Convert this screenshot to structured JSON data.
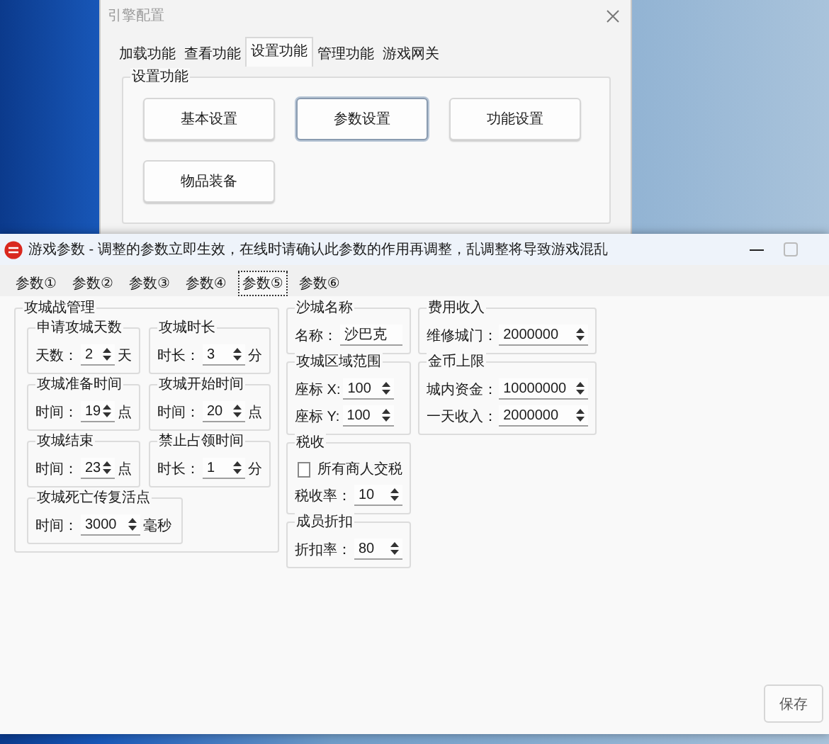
{
  "background_window": {
    "title": "引擎配置",
    "tabs": [
      {
        "label": "加载功能",
        "selected": false
      },
      {
        "label": "查看功能",
        "selected": false
      },
      {
        "label": "设置功能",
        "selected": true
      },
      {
        "label": "管理功能",
        "selected": false
      },
      {
        "label": "游戏网关",
        "selected": false
      }
    ],
    "group": {
      "title": "设置功能",
      "buttons": [
        {
          "label": "基本设置",
          "focused": false
        },
        {
          "label": "参数设置",
          "focused": true
        },
        {
          "label": "功能设置",
          "focused": false
        },
        {
          "label": "物品装备",
          "focused": false
        }
      ]
    }
  },
  "window": {
    "title": "游戏参数 - 调整的参数立即生效，在线时请确认此参数的作用再调整，乱调整将导致游戏混乱",
    "tabs": [
      {
        "label": "参数①",
        "selected": false
      },
      {
        "label": "参数②",
        "selected": false
      },
      {
        "label": "参数③",
        "selected": false
      },
      {
        "label": "参数④",
        "selected": false
      },
      {
        "label": "参数⑤",
        "selected": true
      },
      {
        "label": "参数⑥",
        "selected": false
      }
    ],
    "columns": [
      {
        "title": "攻城战管理",
        "groups": [
          {
            "title": "申请攻城天数",
            "fields": [
              {
                "kind": "spin",
                "label": "天数：",
                "value": "2",
                "unit": "天"
              }
            ]
          },
          {
            "title": "攻城时长",
            "fields": [
              {
                "kind": "spin",
                "label": "时长：",
                "value": "3",
                "unit": "分"
              }
            ]
          },
          {
            "title": "攻城准备时间",
            "fields": [
              {
                "kind": "spin",
                "label": "时间：",
                "value": "19",
                "unit": "点"
              }
            ]
          },
          {
            "title": "攻城开始时间",
            "fields": [
              {
                "kind": "spin",
                "label": "时间：",
                "value": "20",
                "unit": "点"
              }
            ]
          },
          {
            "title": "攻城结束",
            "fields": [
              {
                "kind": "spin",
                "label": "时间：",
                "value": "23",
                "unit": "点"
              }
            ]
          },
          {
            "title": "禁止占领时间",
            "fields": [
              {
                "kind": "spin",
                "label": "时长：",
                "value": "1",
                "unit": "分"
              }
            ]
          },
          {
            "title": "攻城死亡传复活点",
            "fields": [
              {
                "kind": "spin",
                "label": "时间：",
                "value": "3000",
                "unit": "毫秒"
              }
            ]
          }
        ]
      },
      {
        "groups": [
          {
            "title": "沙城名称",
            "fields": [
              {
                "kind": "text",
                "label": "名称：",
                "value": "沙巴克"
              }
            ]
          },
          {
            "title": "攻城区域范围",
            "fields": [
              {
                "kind": "spin",
                "label": "座标 X:",
                "value": "100"
              },
              {
                "kind": "spin",
                "label": "座标 Y:",
                "value": "100"
              }
            ]
          },
          {
            "title": "税收",
            "fields": [
              {
                "kind": "checkbox",
                "label": "所有商人交税",
                "checked": false
              },
              {
                "kind": "spin",
                "label": "税收率：",
                "value": "10"
              }
            ]
          },
          {
            "title": "成员折扣",
            "fields": [
              {
                "kind": "spin",
                "label": "折扣率：",
                "value": "80"
              }
            ]
          }
        ]
      },
      {
        "groups": [
          {
            "title": "费用收入",
            "fields": [
              {
                "kind": "spin",
                "label": "维修城门：",
                "value": "2000000"
              }
            ]
          },
          {
            "title": "金币上限",
            "fields": [
              {
                "kind": "spin",
                "label": "城内资金：",
                "value": "10000000"
              },
              {
                "kind": "spin",
                "label": "一天收入：",
                "value": "2000000"
              }
            ]
          }
        ]
      }
    ],
    "save_button": "保存"
  }
}
